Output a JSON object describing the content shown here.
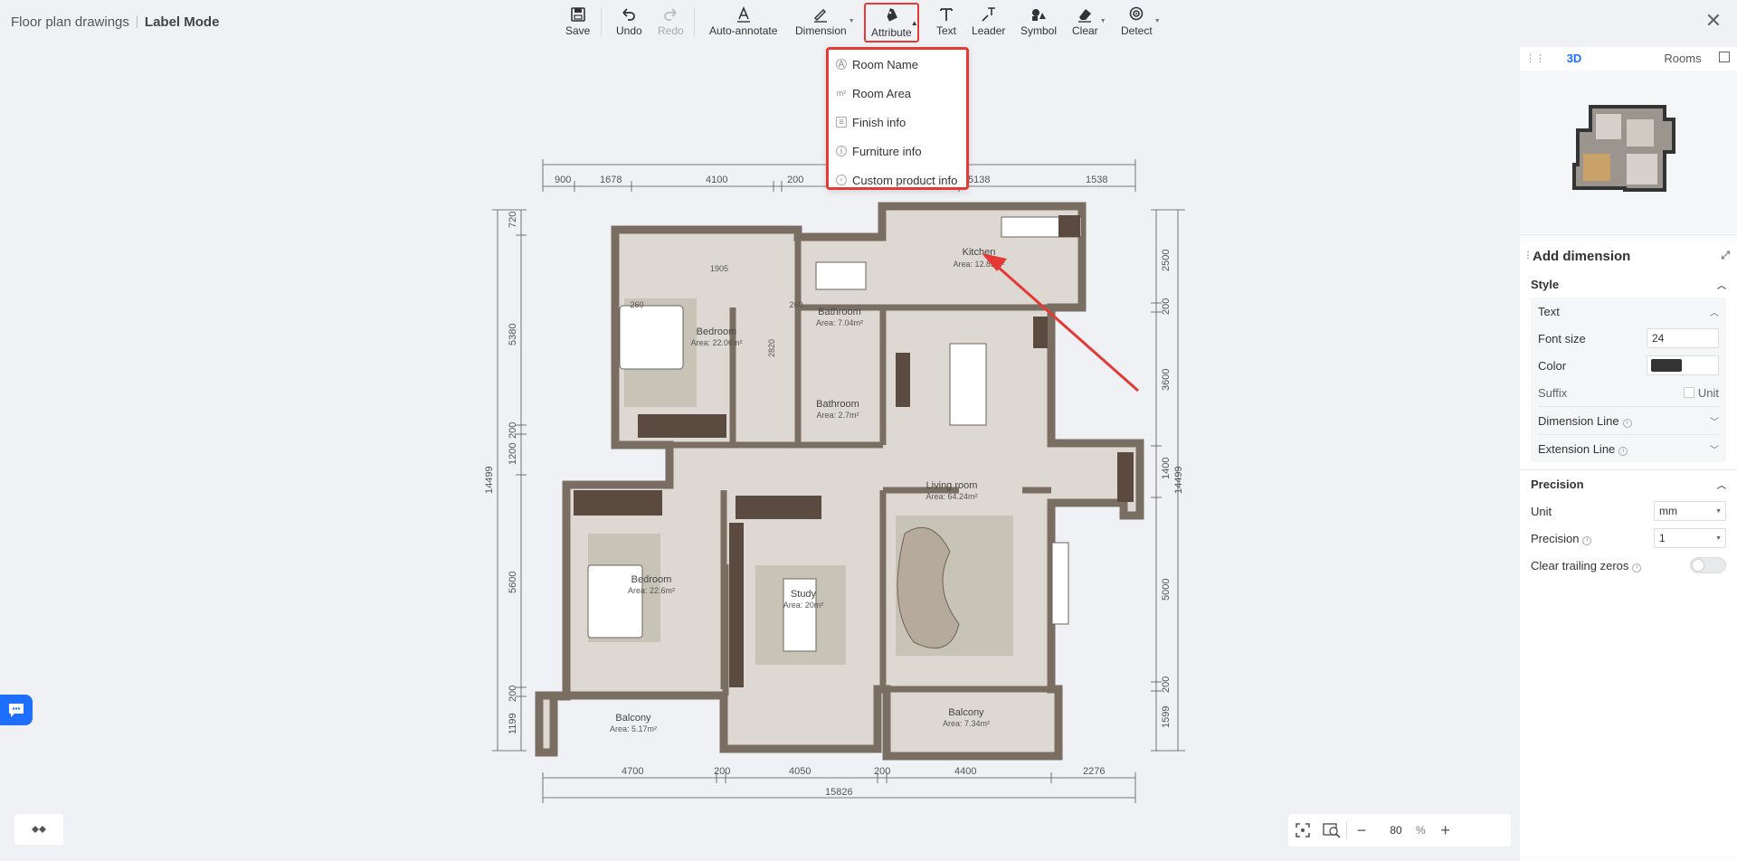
{
  "header": {
    "app_title": "Floor plan drawings",
    "mode": "Label Mode"
  },
  "toolbar": {
    "save": "Save",
    "undo": "Undo",
    "redo": "Redo",
    "auto_annotate": "Auto-annotate",
    "dimension": "Dimension",
    "attribute": "Attribute",
    "text": "Text",
    "leader": "Leader",
    "symbol": "Symbol",
    "clear": "Clear",
    "detect": "Detect"
  },
  "attribute_menu": {
    "items": [
      {
        "label": "Room Name",
        "icon": "room-name-icon"
      },
      {
        "label": "Room Area",
        "icon": "room-area-icon"
      },
      {
        "label": "Finish info",
        "icon": "finish-info-icon"
      },
      {
        "label": "Furniture info",
        "icon": "furniture-info-icon"
      },
      {
        "label": "Custom product info",
        "icon": "custom-product-icon"
      }
    ]
  },
  "plan": {
    "dims_top": [
      "900",
      "1678",
      "4100",
      "200",
      "5138",
      "1538"
    ],
    "dims_bottom": [
      "4700",
      "200",
      "4050",
      "200",
      "4400",
      "2276"
    ],
    "total_bottom": "15826",
    "dims_left": [
      "720",
      "5380",
      "200",
      "1200",
      "5600",
      "200",
      "1199"
    ],
    "total_left": "14499",
    "dims_right": [
      "2500",
      "200",
      "3600",
      "1400",
      "5000",
      "200",
      "1599"
    ],
    "total_right": "14499",
    "rooms": [
      {
        "name": "Kitchen",
        "area": "Area: 12.83m²"
      },
      {
        "name": "Bathroom",
        "area": "Area: 7.04m²"
      },
      {
        "name": "Bedroom",
        "area": "Area: 22.06m²"
      },
      {
        "name": "Bathroom",
        "area": "Area: 2.7m²"
      },
      {
        "name": "Living room",
        "area": "Area: 64.24m²"
      },
      {
        "name": "Bedroom",
        "area": "Area: 22.6m²"
      },
      {
        "name": "Study",
        "area": "Area: 20m²"
      },
      {
        "name": "Balcony",
        "area": "Area: 5.17m²"
      },
      {
        "name": "Balcony",
        "area": "Area: 7.34m²"
      }
    ],
    "inner_dims": [
      "1905",
      "260",
      "260",
      "2820"
    ]
  },
  "minimap": {
    "tabs": [
      "3D",
      "Rooms"
    ]
  },
  "panel": {
    "title": "Add dimension",
    "style": "Style",
    "text_section": "Text",
    "font_size_label": "Font size",
    "font_size_value": "24",
    "color_label": "Color",
    "color_value": "#333333",
    "suffix_label": "Suffix",
    "unit_checkbox": "Unit",
    "dimension_line": "Dimension Line",
    "extension_line": "Extension Line",
    "precision_section": "Precision",
    "unit_label": "Unit",
    "unit_value": "mm",
    "precision_label": "Precision",
    "precision_value": "1",
    "clear_zeros_label": "Clear trailing zeros"
  },
  "zoom": {
    "value": "80",
    "unit": "%"
  }
}
